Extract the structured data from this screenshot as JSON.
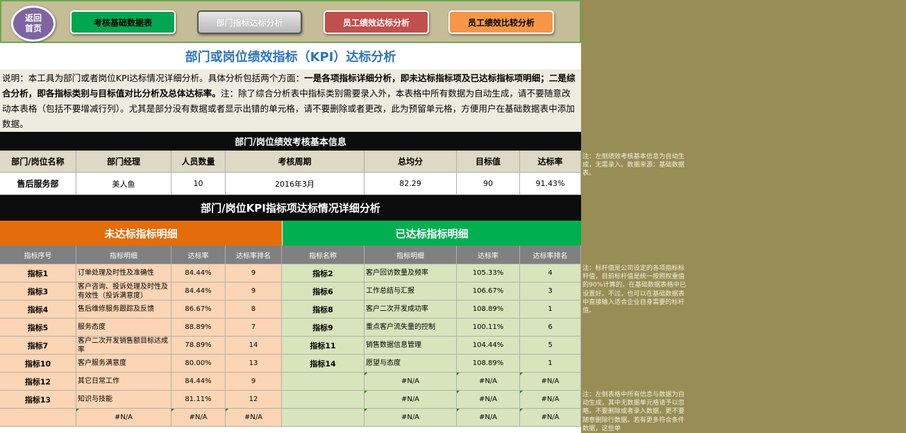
{
  "nav": {
    "home_line1": "返回",
    "home_line2": "首页",
    "btn1": "考核基础数据表",
    "btn2": "部门指标达标分析",
    "btn3": "员工绩效达标分析",
    "btn4": "员工绩效比较分析",
    "colors": {
      "btn1": "#00a651",
      "btn2": "#c8c8c8",
      "btn3": "#c0504d",
      "btn4": "#f79646"
    }
  },
  "sheet": {
    "title": "部门或岗位绩效指标（KPI）达标分析",
    "desc": {
      "p1": "说明：本工具为部门或者岗位KPI达标情况详细分析。具体分析包括两个方面：",
      "p2": "一是各项指标详细分析，即未达标指标项及已达标指标项明细；二是综合分析，即各指标类别与目标值对比分析及总体达标率。",
      "p3": "注：除了综合分析表中指标类别需要录入外，本表格中所有数据为自动生成，请不要随意改动本表格（包括不要增减行列）。尤其是部分没有数据或者显示出错的单元格，请不要删除或者更改，此为预留单元格，方便用户在基础数据表中添加数据。"
    },
    "info_title": "部门/岗位绩效考核基本信息",
    "info_headers": [
      "部门/岗位名称",
      "部门经理",
      "人员数量",
      "考核周期",
      "总均分",
      "目标值",
      "达标率"
    ],
    "info_values": [
      "售后服务部",
      "美人鱼",
      "10",
      "2016年3月",
      "82.29",
      "90",
      "91.43%"
    ],
    "kpi_title": "部门/岗位KPI指标项达标情况详细分析",
    "fail_title": "未达标指标明细",
    "pass_title": "已达标指标明细",
    "fail_headers": [
      "指标序号",
      "指标明细",
      "达标率",
      "达标率排名"
    ],
    "pass_headers": [
      "指标名称",
      "指标明细",
      "达标率",
      "达标率排名"
    ],
    "fail_rows": [
      [
        "指标1",
        "订单处理及时性及准确性",
        "84.44%",
        "9"
      ],
      [
        "指标3",
        "客户咨询、投诉处理及时性及有效性（投诉满意度）",
        "84.44%",
        "9"
      ],
      [
        "指标4",
        "售后维修服务跟踪及反馈",
        "86.67%",
        "8"
      ],
      [
        "指标5",
        "服务态度",
        "88.89%",
        "7"
      ],
      [
        "指标7",
        "客户二次开发销售额目标达成率",
        "78.89%",
        "14"
      ],
      [
        "指标10",
        "客户服务满意度",
        "80.00%",
        "13"
      ],
      [
        "指标12",
        "其它日常工作",
        "84.44%",
        "9"
      ],
      [
        "指标13",
        "知识与技能",
        "81.11%",
        "12"
      ],
      [
        "",
        "#N/A",
        "#N/A",
        "#N/A"
      ]
    ],
    "pass_rows": [
      [
        "指标2",
        "客户回访数量及频率",
        "105.33%",
        "4"
      ],
      [
        "指标6",
        "工作总结与汇报",
        "106.67%",
        "3"
      ],
      [
        "指标8",
        "客户二次开发成功率",
        "108.89%",
        "1"
      ],
      [
        "指标9",
        "重点客户流失量的控制",
        "100.11%",
        "6"
      ],
      [
        "指标11",
        "销售数据信息管理",
        "104.44%",
        "5"
      ],
      [
        "指标14",
        "愿望与态度",
        "108.89%",
        "1"
      ],
      [
        "",
        "#N/A",
        "#N/A",
        "#N/A"
      ],
      [
        "",
        "#N/A",
        "#N/A",
        "#N/A"
      ],
      [
        "",
        "#N/A",
        "#N/A",
        "#N/A"
      ]
    ]
  },
  "notes": {
    "n1": "注：左侧绩效考核基本信息为自动生成，无需录入。数据来源：基础数据表。",
    "n2": "注：标杆值是公司设定的各项指标标杆值，目前标杆值是统一按照权重值的90%计算的，在基础数据表格中已设置好。不过，也可以在基础数据表中直接输入适合企业自身需要的标杆值。",
    "n3": "注：左侧表格中所有信息与数据为自动生成，其中无数据单元格请予以忽略，不要删除或者录入数据，更不要随意删除行数据。若有更多符合条件数据，这些单"
  }
}
